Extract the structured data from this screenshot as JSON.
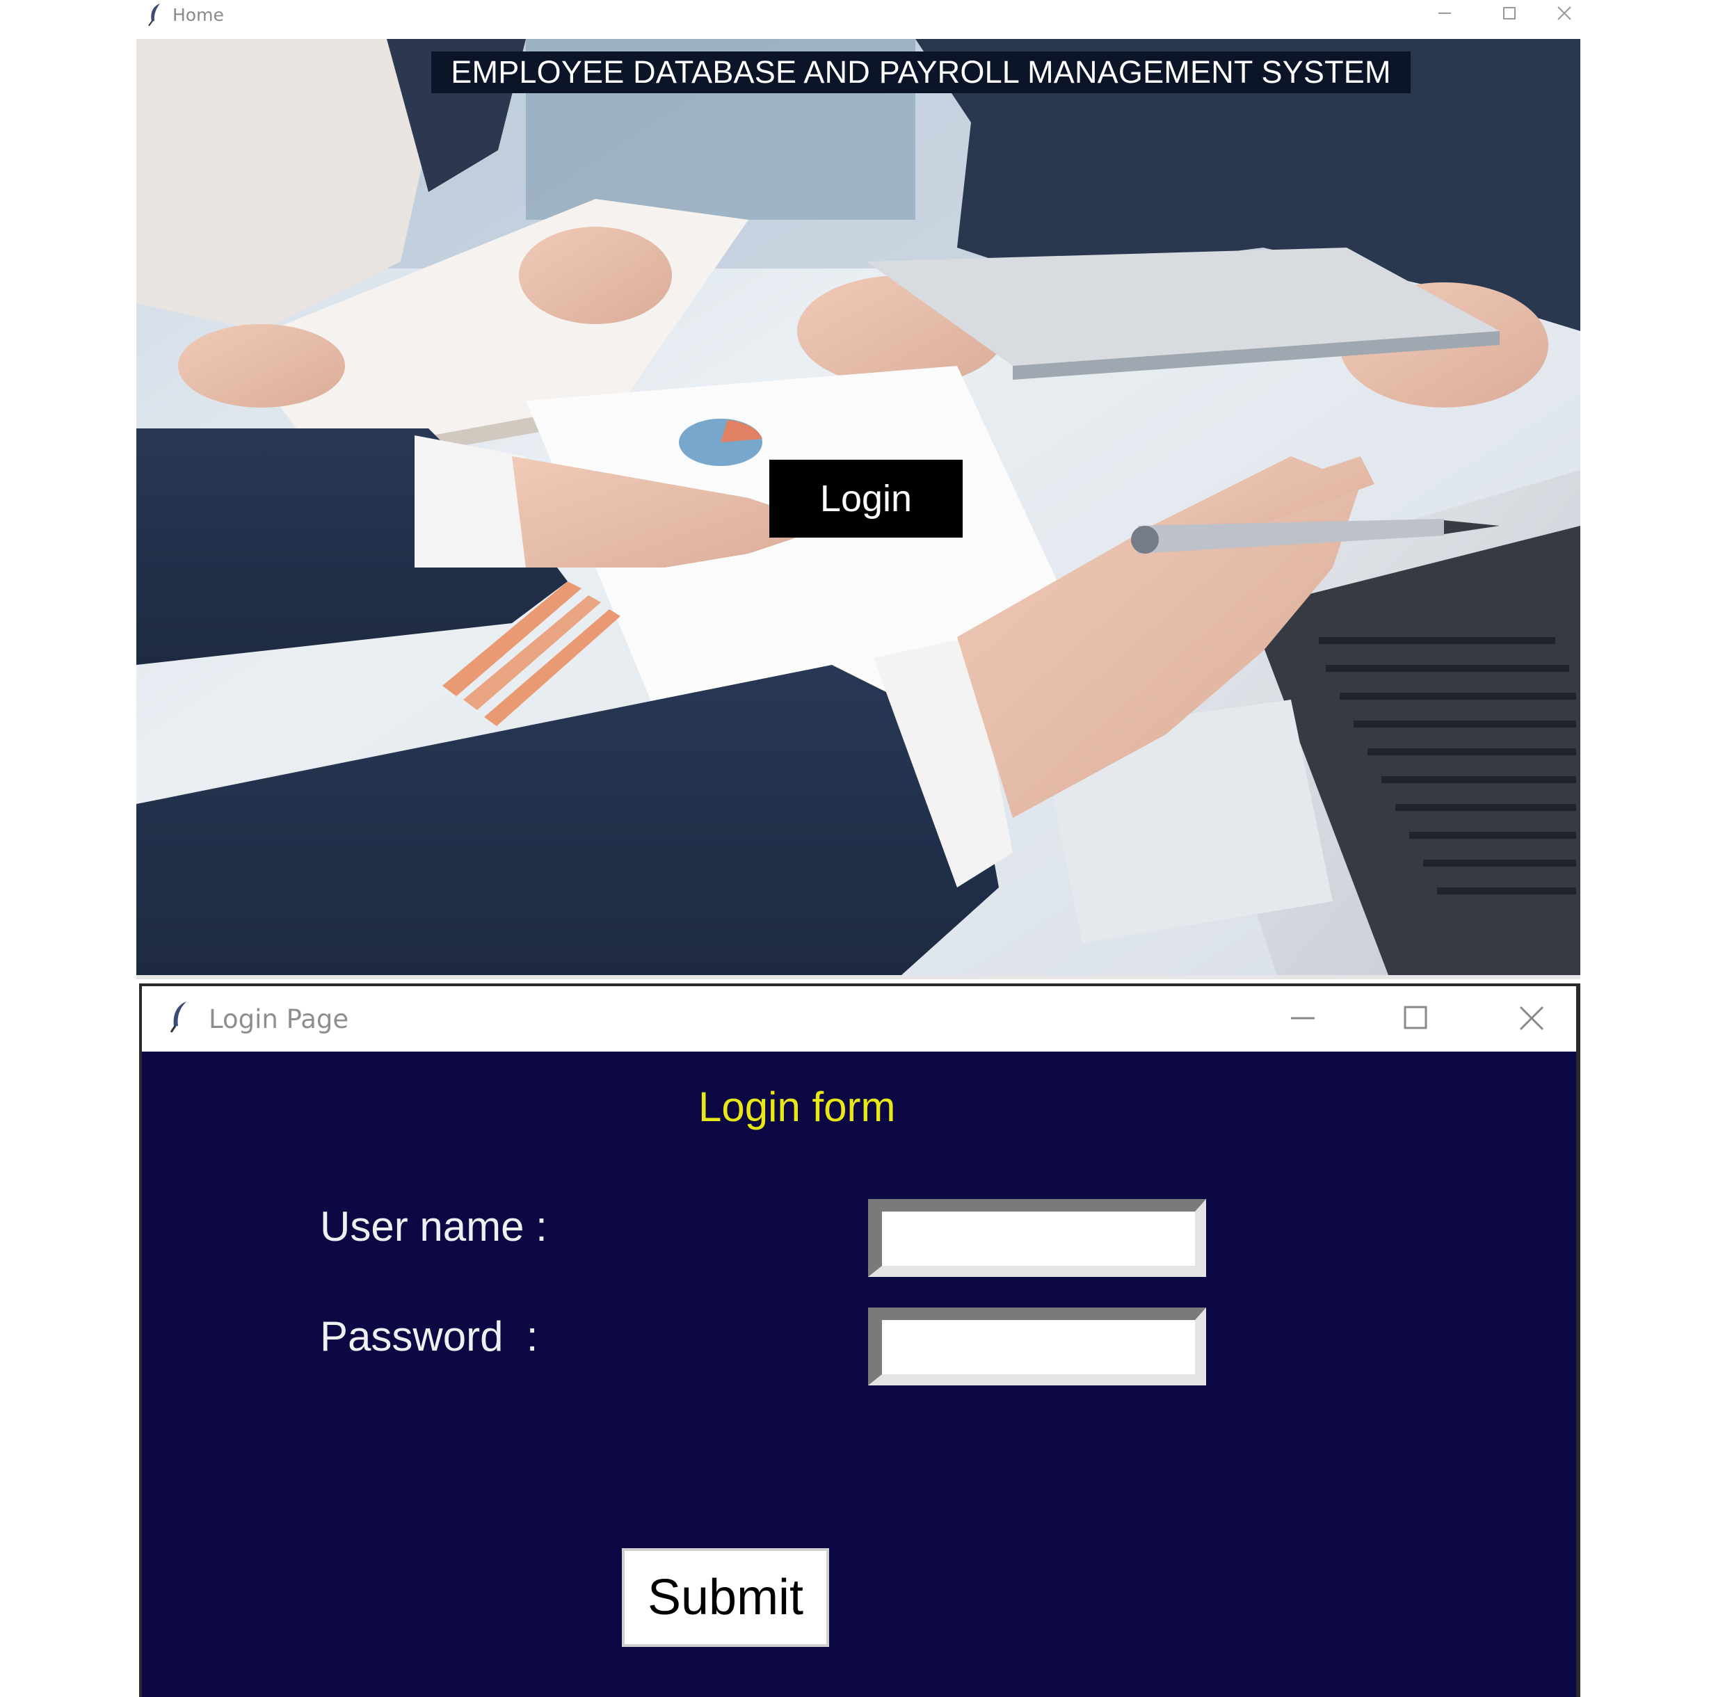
{
  "home_window": {
    "title": "Home",
    "banner_text": "EMPLOYEE DATABASE AND PAYROLL MANAGEMENT SYSTEM",
    "login_button_label": "Login"
  },
  "login_window": {
    "title": "Login Page",
    "form_title": "Login form",
    "username_label": "User name :",
    "password_label": "Password  :",
    "username_value": "",
    "password_value": "",
    "submit_label": "Submit"
  },
  "icons": {
    "app_icon": "feather-icon",
    "minimize": "minimize-icon",
    "maximize": "maximize-icon",
    "close": "close-icon"
  },
  "colors": {
    "login_bg": "#0b0844",
    "form_title": "#e8e817",
    "banner_bg": "#0c1428",
    "login_button_bg": "#000000"
  }
}
